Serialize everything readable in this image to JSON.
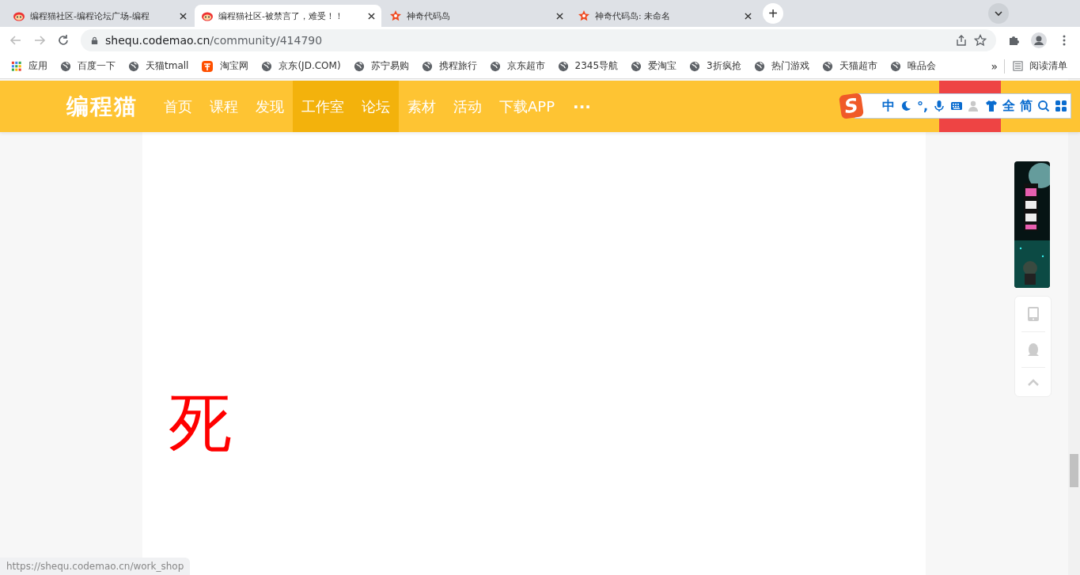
{
  "browser": {
    "tabs": [
      {
        "title": "编程猫社区-编程论坛广场-编程",
        "selected": false
      },
      {
        "title": "编程猫社区-被禁言了，难受！！",
        "selected": true
      },
      {
        "title": "神奇代码岛",
        "selected": false
      },
      {
        "title": "神奇代码岛: 未命名",
        "selected": false
      }
    ],
    "new_tab": "+",
    "address": {
      "host": "shequ.codemao.cn",
      "path": "/community/414790"
    },
    "bookmarks": [
      "应用",
      "百度一下",
      "天猫tmall",
      "淘宝网",
      "京东(JD.COM)",
      "苏宁易购",
      "携程旅行",
      "京东超市",
      "2345导航",
      "爱淘宝",
      "3折疯抢",
      "热门游戏",
      "天猫超市",
      "唯品会"
    ],
    "more_bookmarks": "»",
    "reading_list": "阅读清单",
    "status_url": "https://shequ.codemao.cn/work_shop"
  },
  "site": {
    "logo": "编程猫",
    "nav": [
      {
        "label": "首页",
        "selected": false
      },
      {
        "label": "课程",
        "selected": false
      },
      {
        "label": "发现",
        "selected": false
      },
      {
        "label": "工作室",
        "selected": true
      },
      {
        "label": "论坛",
        "selected": true
      },
      {
        "label": "素材",
        "selected": false
      },
      {
        "label": "活动",
        "selected": false
      },
      {
        "label": "下载APP",
        "selected": false
      }
    ],
    "more": "···",
    "post_text": "死"
  },
  "ime_bar": {
    "logo": "S",
    "items": [
      {
        "kind": "text",
        "label": "中"
      },
      {
        "kind": "icon"
      },
      {
        "kind": "text",
        "label": "°,"
      },
      {
        "kind": "icon"
      },
      {
        "kind": "icon"
      },
      {
        "kind": "icon"
      },
      {
        "kind": "icon"
      },
      {
        "kind": "text",
        "label": "全"
      },
      {
        "kind": "text",
        "label": "简"
      },
      {
        "kind": "icon"
      },
      {
        "kind": "icon"
      }
    ]
  }
}
